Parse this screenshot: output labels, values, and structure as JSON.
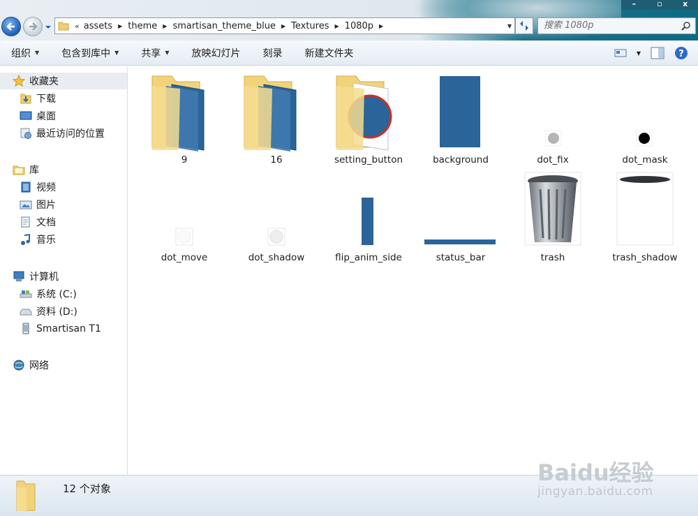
{
  "window": {
    "search_placeholder": "搜索 1080p"
  },
  "breadcrumbs": [
    "assets",
    "theme",
    "smartisan_theme_blue",
    "Textures",
    "1080p"
  ],
  "address_prefix": "«",
  "toolbar": {
    "organize": "组织",
    "include_library": "包含到库中",
    "share": "共享",
    "slideshow": "放映幻灯片",
    "burn": "刻录",
    "new_folder": "新建文件夹"
  },
  "sidebar": {
    "favorites": "收藏夹",
    "downloads": "下载",
    "desktop": "桌面",
    "recent": "最近访问的位置",
    "libraries": "库",
    "videos": "视频",
    "pictures": "图片",
    "documents": "文档",
    "music": "音乐",
    "computer": "计算机",
    "drive_c": "系统 (C:)",
    "drive_d": "资料 (D:)",
    "device": "Smartisan T1",
    "network": "网络"
  },
  "files": [
    {
      "name": "9",
      "kind": "folder"
    },
    {
      "name": "16",
      "kind": "folder"
    },
    {
      "name": "setting_button",
      "kind": "folder"
    },
    {
      "name": "background",
      "kind": "image"
    },
    {
      "name": "dot_fix",
      "kind": "image"
    },
    {
      "name": "dot_mask",
      "kind": "image"
    },
    {
      "name": "dot_move",
      "kind": "image"
    },
    {
      "name": "dot_shadow",
      "kind": "image"
    },
    {
      "name": "flip_anim_side",
      "kind": "image"
    },
    {
      "name": "status_bar",
      "kind": "image"
    },
    {
      "name": "trash",
      "kind": "image"
    },
    {
      "name": "trash_shadow",
      "kind": "image"
    }
  ],
  "status": {
    "count_text": "12 个对象"
  },
  "watermark": {
    "brand": "Baidu经验",
    "url": "jingyan.baidu.com"
  },
  "colors": {
    "accent": "#2a6498",
    "folder": "#f3d98a",
    "toolbar_bg": "#e9f0f7"
  }
}
